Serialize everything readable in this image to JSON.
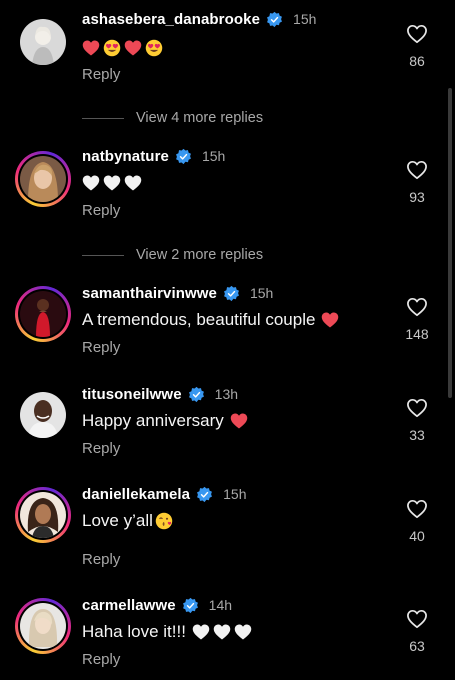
{
  "comments": [
    {
      "username": "ashasebera_danabrooke",
      "time": "15h",
      "text": "",
      "emojis": [
        "red-heart",
        "heart-eyes",
        "red-heart",
        "heart-eyes"
      ],
      "reply": "Reply",
      "likes": "86"
    },
    {
      "username": "natbynature",
      "time": "15h",
      "text": "",
      "emojis": [
        "white-heart",
        "white-heart",
        "white-heart"
      ],
      "reply": "Reply",
      "likes": "93"
    },
    {
      "username": "samanthairvinwwe",
      "time": "15h",
      "text": "A tremendous, beautiful couple",
      "emojis": [
        "red-heart"
      ],
      "reply": "Reply",
      "likes": "148"
    },
    {
      "username": "titusoneilwwe",
      "time": "13h",
      "text": "Happy anniversary",
      "emojis": [
        "red-heart"
      ],
      "reply": "Reply",
      "likes": "33"
    },
    {
      "username": "daniellekamela",
      "time": "15h",
      "text": "Love y’all",
      "emojis": [
        "kiss-face"
      ],
      "reply": "Reply",
      "likes": "40"
    },
    {
      "username": "carmellawwe",
      "time": "14h",
      "text": "Haha love it!!!",
      "emojis": [
        "white-heart",
        "white-heart",
        "white-heart"
      ],
      "reply": "Reply",
      "likes": "63"
    }
  ],
  "view_more": [
    "View 4 more replies",
    "View 2 more replies"
  ],
  "colors": {
    "background": "#000000",
    "verified": "#3897f0",
    "red_heart": "#ed4956",
    "secondary_text": "#a8a8a8"
  }
}
